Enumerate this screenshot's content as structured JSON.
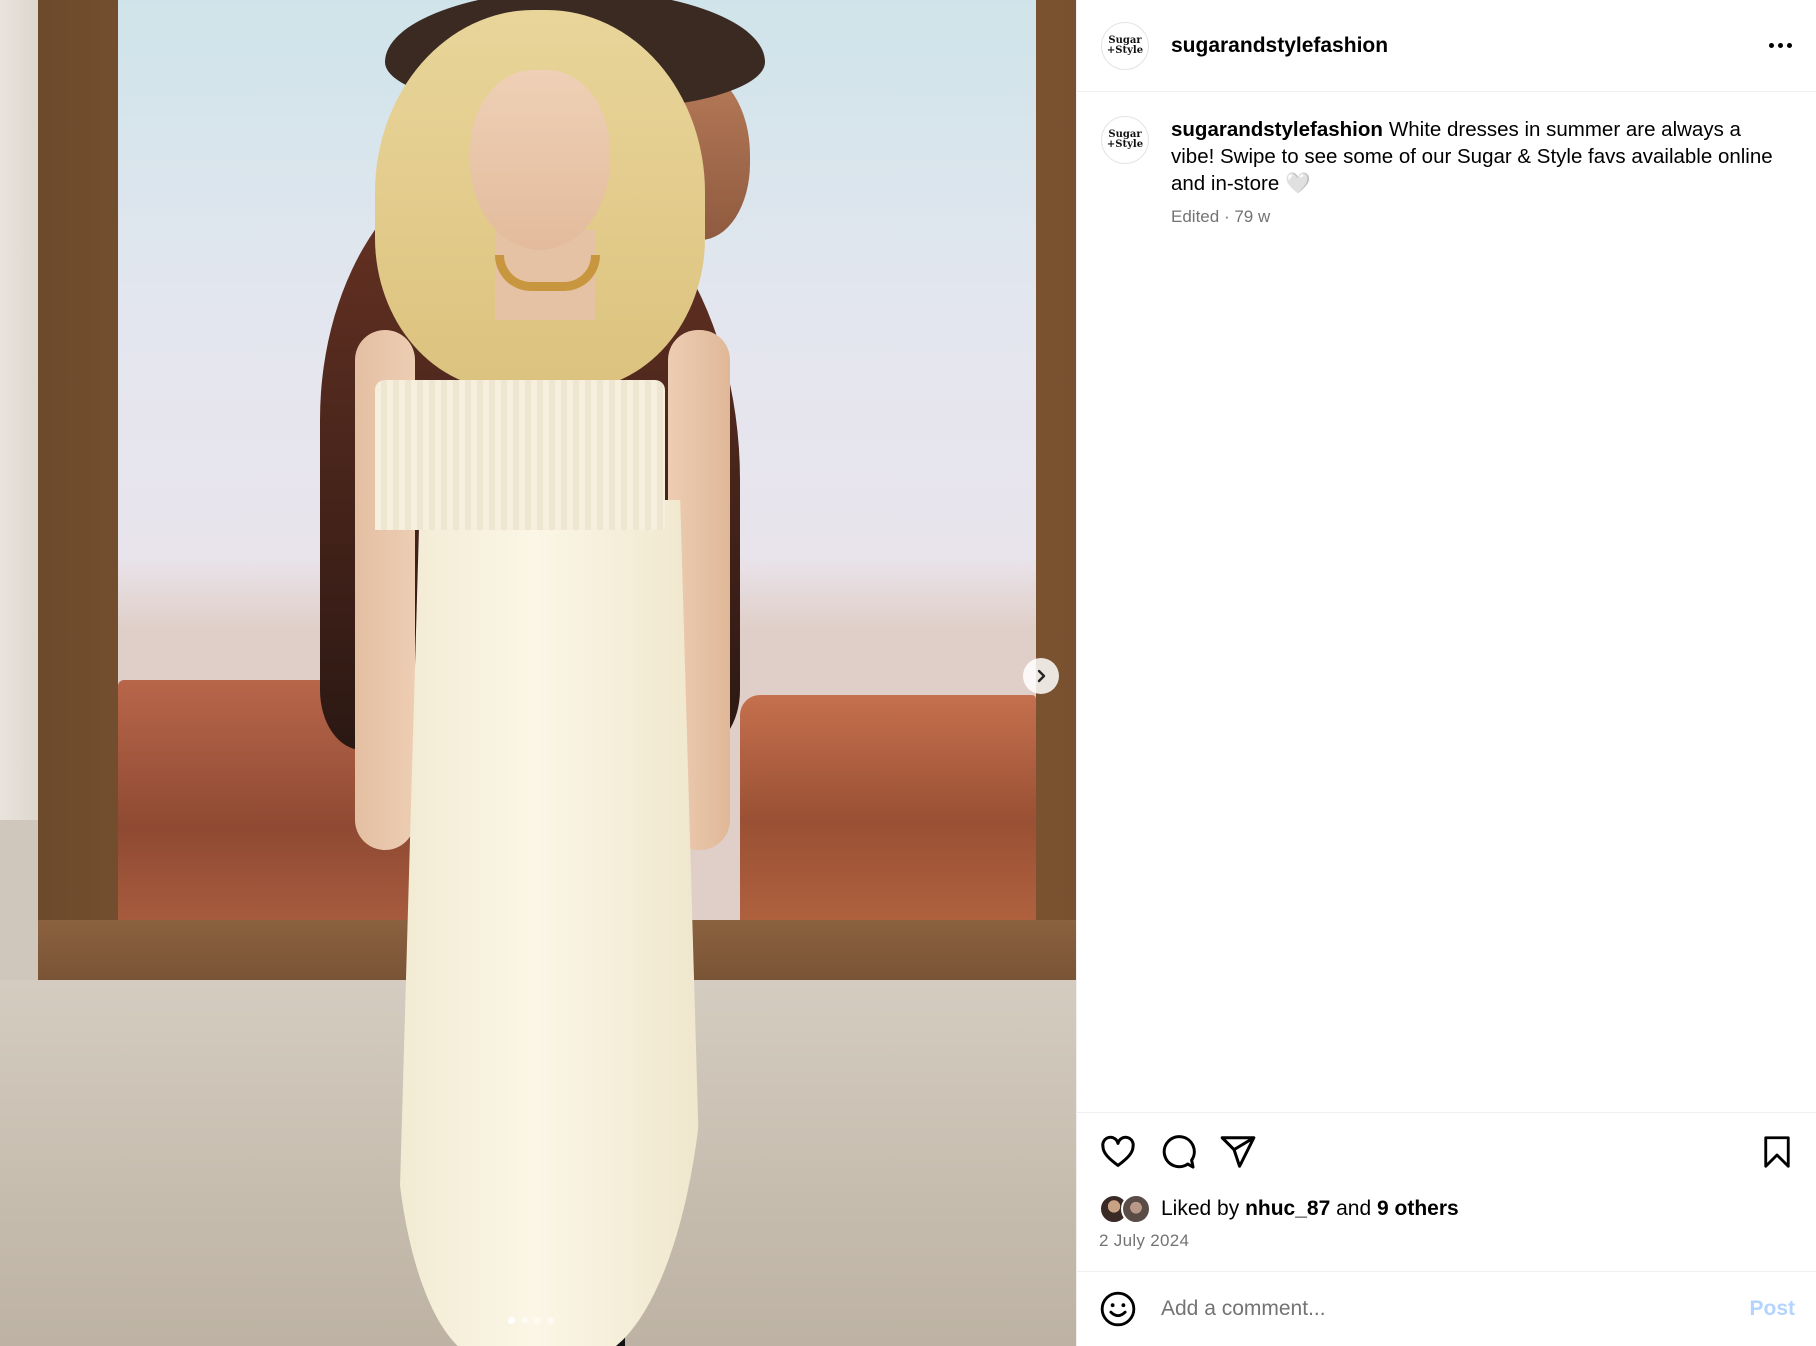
{
  "account": {
    "avatar_line1": "Sugar",
    "avatar_line2": "+Style",
    "username": "sugarandstylefashion"
  },
  "caption": {
    "username": "sugarandstylefashion",
    "text": "White dresses in summer are always a vibe! Swipe to see some of our Sugar & Style favs available online and in-store 🤍",
    "edited": "Edited",
    "separator": "·",
    "age": "79 w"
  },
  "likes": {
    "prefix": "Liked by",
    "user": "nhuc_87",
    "connector": "and",
    "others": "9 others"
  },
  "date": "2 July 2024",
  "comment": {
    "placeholder": "Add a comment...",
    "post_label": "Post"
  },
  "carousel": {
    "slide_count": 4,
    "active_index": 0
  },
  "colors": {
    "post_button": "#b3d4fc",
    "muted_text": "#737373",
    "divider": "#efefef"
  }
}
